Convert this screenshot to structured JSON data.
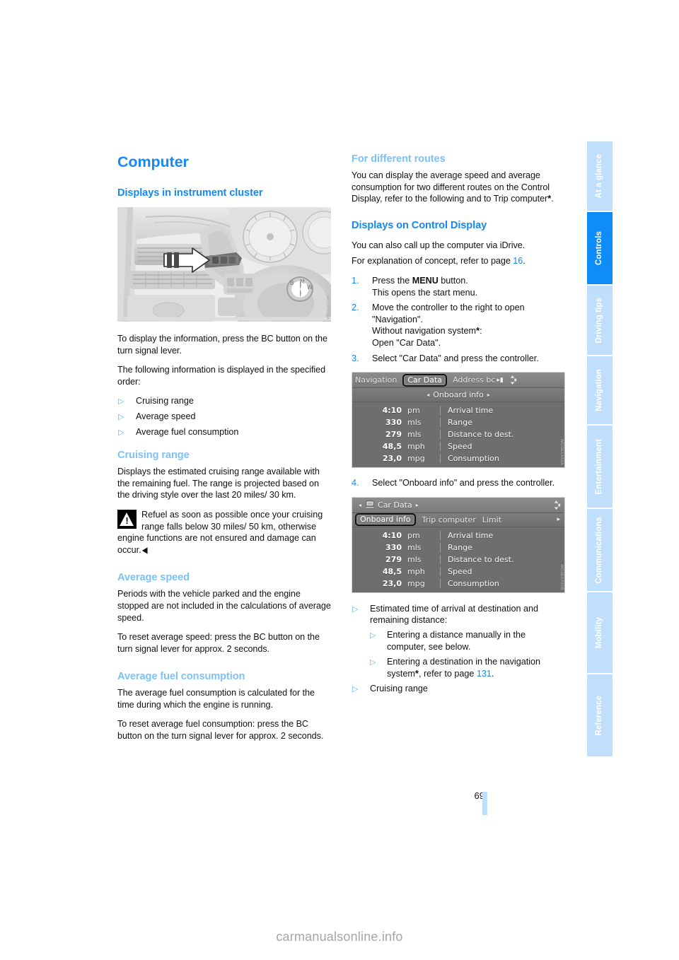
{
  "document": {
    "page_number": "69",
    "watermark": "carmanualsonline.info"
  },
  "side_tabs": [
    {
      "label": "At a glance",
      "active": false
    },
    {
      "label": "Controls",
      "active": true
    },
    {
      "label": "Driving tips",
      "active": false
    },
    {
      "label": "Navigation",
      "active": false
    },
    {
      "label": "Entertainment",
      "active": false
    },
    {
      "label": "Communications",
      "active": false
    },
    {
      "label": "Mobility",
      "active": false
    },
    {
      "label": "Reference",
      "active": false
    }
  ],
  "left_column": {
    "chapter_title": "Computer",
    "section_heading": "Displays in instrument cluster",
    "photo_credit": "WCI1E0ICAA",
    "para_1": "To display the information, press the BC button on the turn signal lever.",
    "para_2": "The following information is displayed in the specified order:",
    "bullets": [
      "Cruising range",
      "Average speed",
      "Average fuel consumption"
    ],
    "cruising_range": {
      "heading": "Cruising range",
      "para_1": "Displays the estimated cruising range available with the remaining fuel. The range is projected based on the driving style over the last 20 miles/ 30 km.",
      "warning": "Refuel as soon as possible once your cruising range falls below 30 miles/ 50 km, otherwise engine functions are not ensured and damage can occur."
    },
    "average_speed": {
      "heading": "Average speed",
      "para_1": "Periods with the vehicle parked and the engine stopped are not included in the calculations of average speed.",
      "para_2": "To reset average speed: press the BC button on the turn signal lever for approx. 2 seconds."
    },
    "average_fuel": {
      "heading": "Average fuel consumption",
      "para_1": "The average fuel consumption is calculated for the time during which the engine is running.",
      "para_2": "To reset average fuel consumption: press the BC button on the turn signal lever for approx. 2 seconds."
    }
  },
  "right_column": {
    "routes": {
      "heading": "For different routes",
      "para_1_a": "You can display the average speed and average consumption for two different routes on the Control Display, refer to the following and to Trip computer",
      "para_1_b": "."
    },
    "control_display": {
      "heading": "Displays on Control Display",
      "para_1": "You can also call up the computer via iDrive.",
      "para_2_a": "For explanation of concept, refer to page ",
      "para_2_ref": "16",
      "para_2_b": ".",
      "steps": [
        {
          "num": "1.",
          "text_a": "Press the ",
          "bold": "MENU",
          "text_b": " button.",
          "line2": "This opens the start menu.",
          "line3": "",
          "line4": ""
        },
        {
          "num": "2.",
          "text_a": "Move the controller to the right to open",
          "bold": "",
          "text_b": "",
          "line2": "\"Navigation\".",
          "line3": "Without navigation system",
          "line4": "Open \"Car Data\"."
        },
        {
          "num": "3.",
          "text_a": "Select \"Car Data\" and press the controller.",
          "bold": "",
          "text_b": "",
          "line2": "",
          "line3": "",
          "line4": ""
        }
      ],
      "step_4": {
        "num": "4.",
        "text": "Select \"Onboard info\" and press the controller."
      }
    },
    "screenshot_1": {
      "credit": "WCI1EXXXXA",
      "tab_left": "Navigation",
      "tab_selected": "Car Data",
      "tab_right": "Address bc",
      "subtitle": "Onboard info",
      "rows": [
        {
          "value": "4:10",
          "unit": "pm",
          "label": "Arrival time"
        },
        {
          "value": "330",
          "unit": "mls",
          "label": "Range"
        },
        {
          "value": "279",
          "unit": "mls",
          "label": "Distance to dest."
        },
        {
          "value": "48,5",
          "unit": "mph",
          "label": "Speed"
        },
        {
          "value": "23,0",
          "unit": "mpg",
          "label": "Consumption"
        }
      ]
    },
    "screenshot_2": {
      "credit": "WCI1EXXXXB",
      "title": "Car Data",
      "tab_selected": "Onboard info",
      "tab_2": "Trip computer",
      "tab_3": "Limit",
      "rows": [
        {
          "value": "4:10",
          "unit": "pm",
          "label": "Arrival time"
        },
        {
          "value": "330",
          "unit": "mls",
          "label": "Range"
        },
        {
          "value": "279",
          "unit": "mls",
          "label": "Distance to dest."
        },
        {
          "value": "48,5",
          "unit": "mph",
          "label": "Speed"
        },
        {
          "value": "23,0",
          "unit": "mpg",
          "label": "Consumption"
        }
      ]
    },
    "final_bullets": {
      "item_1": "Estimated time of arrival at destination and remaining distance:",
      "sub_1": "Entering a distance manually in the computer, see below.",
      "sub_2_a": "Entering a destination in the navigation system",
      "sub_2_b": ", refer to page ",
      "sub_2_ref": "131",
      "sub_2_c": ".",
      "item_2": "Cruising range"
    }
  },
  "colors": {
    "heading_blue": "#1689f2",
    "subheading_blue": "#7dc1f7",
    "tab_inactive": "#bfdffc",
    "tab_active": "#0e8cf7"
  }
}
